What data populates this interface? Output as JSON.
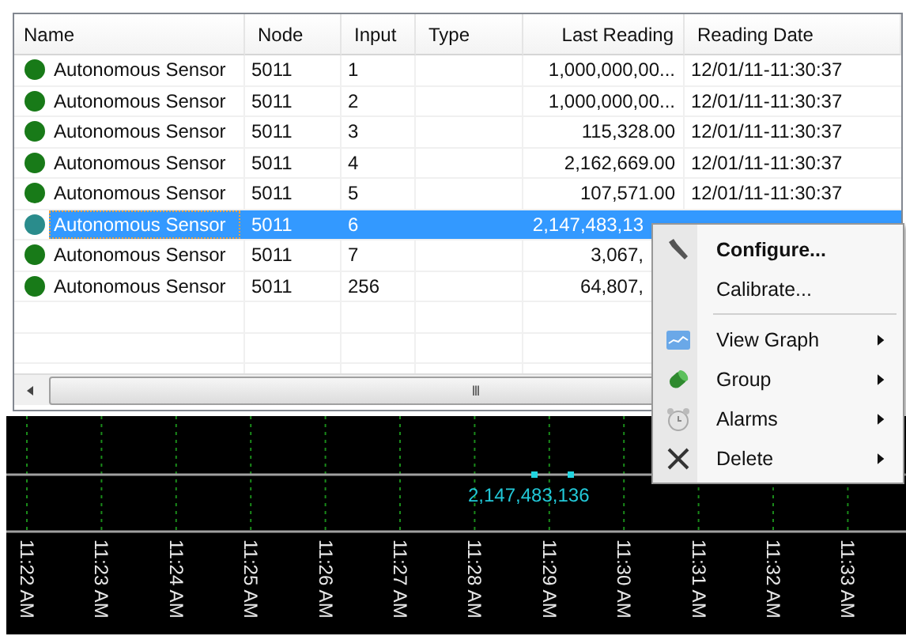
{
  "table": {
    "columns": [
      "Name",
      "Node",
      "Input",
      "Type",
      "Last Reading",
      "Reading Date"
    ],
    "rows": [
      {
        "name": "Autonomous Sensor",
        "color": "#187a18",
        "node": "5011",
        "input": "1",
        "last_reading": "1,000,000,00...",
        "reading_date": "12/01/11-11:30:37",
        "selected": false,
        "under_menu": false
      },
      {
        "name": "Autonomous Sensor",
        "color": "#187a18",
        "node": "5011",
        "input": "2",
        "last_reading": "1,000,000,00...",
        "reading_date": "12/01/11-11:30:37",
        "selected": false,
        "under_menu": false
      },
      {
        "name": "Autonomous Sensor",
        "color": "#187a18",
        "node": "5011",
        "input": "3",
        "last_reading": "115,328.00",
        "reading_date": "12/01/11-11:30:37",
        "selected": false,
        "under_menu": false
      },
      {
        "name": "Autonomous Sensor",
        "color": "#187a18",
        "node": "5011",
        "input": "4",
        "last_reading": "2,162,669.00",
        "reading_date": "12/01/11-11:30:37",
        "selected": false,
        "under_menu": false
      },
      {
        "name": "Autonomous Sensor",
        "color": "#187a18",
        "node": "5011",
        "input": "5",
        "last_reading": "107,571.00",
        "reading_date": "12/01/11-11:30:37",
        "selected": false,
        "under_menu": false
      },
      {
        "name": "Autonomous Sensor",
        "color": "#2a8c8c",
        "node": "5011",
        "input": "6",
        "last_reading": "2,147,483,13",
        "selected": true,
        "under_menu": true
      },
      {
        "name": "Autonomous Sensor",
        "color": "#187a18",
        "node": "5011",
        "input": "7",
        "last_reading": "3,067,",
        "selected": false,
        "under_menu": true
      },
      {
        "name": "Autonomous Sensor",
        "color": "#187a18",
        "node": "5011",
        "input": "256",
        "last_reading": "64,807,",
        "selected": false,
        "under_menu": true
      }
    ],
    "scrollbar_grip": "III"
  },
  "graph": {
    "point_label": "2,147,483,136",
    "time_labels": [
      "11:22 AM",
      "11:23 AM",
      "11:24 AM",
      "11:25 AM",
      "11:26 AM",
      "11:27 AM",
      "11:28 AM",
      "11:29 AM",
      "11:30 AM",
      "11:31 AM",
      "11:32 AM",
      "11:33 AM"
    ]
  },
  "context_menu": {
    "items": [
      {
        "kind": "item",
        "label": "Configure...",
        "default": true,
        "submenu": false
      },
      {
        "kind": "item",
        "label": "Calibrate...",
        "default": false,
        "submenu": false
      },
      {
        "kind": "separator"
      },
      {
        "kind": "item",
        "label": "View Graph",
        "default": false,
        "submenu": true
      },
      {
        "kind": "item",
        "label": "Group",
        "default": false,
        "submenu": true
      },
      {
        "kind": "item",
        "label": "Alarms",
        "default": false,
        "submenu": true
      },
      {
        "kind": "item",
        "label": "Delete",
        "default": false,
        "submenu": true
      }
    ]
  }
}
